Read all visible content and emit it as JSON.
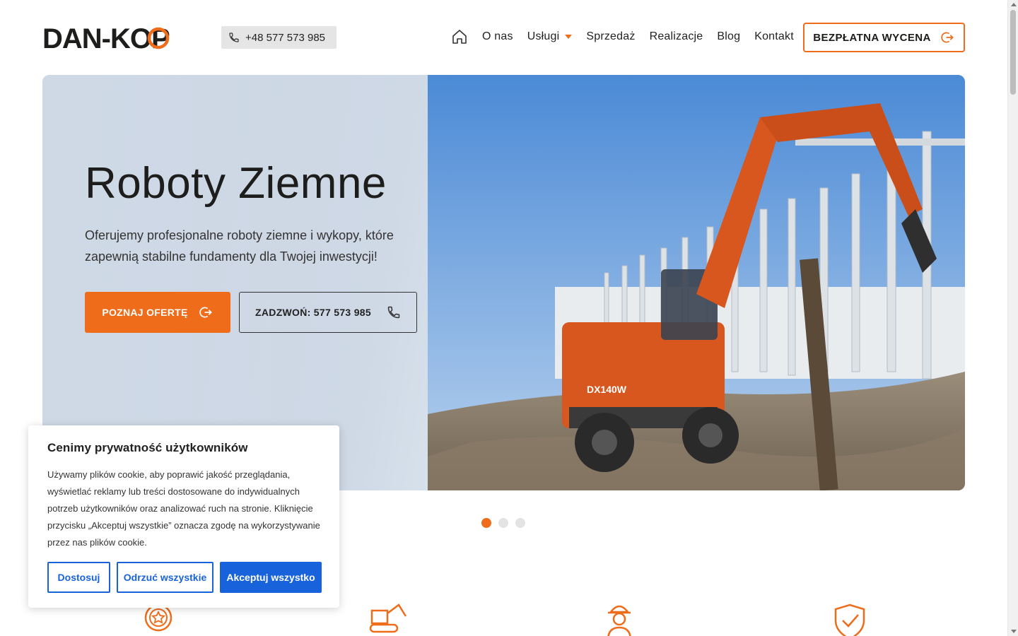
{
  "header": {
    "logo_text": "DAN-KOP",
    "phone": "+48 577 573 985",
    "nav": {
      "home_icon": "home-icon",
      "items": [
        {
          "label": "O nas"
        },
        {
          "label": "Usługi",
          "has_dropdown": true
        },
        {
          "label": "Sprzedaż"
        },
        {
          "label": "Realizacje"
        },
        {
          "label": "Blog"
        },
        {
          "label": "Kontakt"
        }
      ]
    },
    "cta": "BEZPŁATNA WYCENA"
  },
  "hero": {
    "title": "Roboty Ziemne",
    "text": "Oferujemy profesjonalne roboty ziemne i wykopy, które zapewnią stabilne fundamenty dla Twojej inwestycji!",
    "btn_primary": "POZNAJ OFERTĘ",
    "btn_secondary": "ZADZWOŃ: 577 573 985",
    "machine_label": "DX140W"
  },
  "slider": {
    "count": 3,
    "active_index": 0
  },
  "features": {
    "icons": [
      "award-badge-icon",
      "excavator-icon",
      "worker-icon",
      "shield-check-icon"
    ]
  },
  "cookie": {
    "title": "Cenimy prywatność użytkowników",
    "text": "Używamy plików cookie, aby poprawić jakość przeglądania, wyświetlać reklamy lub treści dostosowane do indywidualnych potrzeb użytkowników oraz analizować ruch na stronie. Kliknięcie przycisku „Akceptuj wszystkie” oznacza zgodę na wykorzystywanie przez nas plików cookie.",
    "btn_customize": "Dostosuj",
    "btn_reject": "Odrzuć wszystkie",
    "btn_accept": "Akceptuj wszystko"
  },
  "colors": {
    "accent": "#ef6c1a",
    "cookie_blue": "#1863dc",
    "text_dark": "#1d1d1b"
  }
}
